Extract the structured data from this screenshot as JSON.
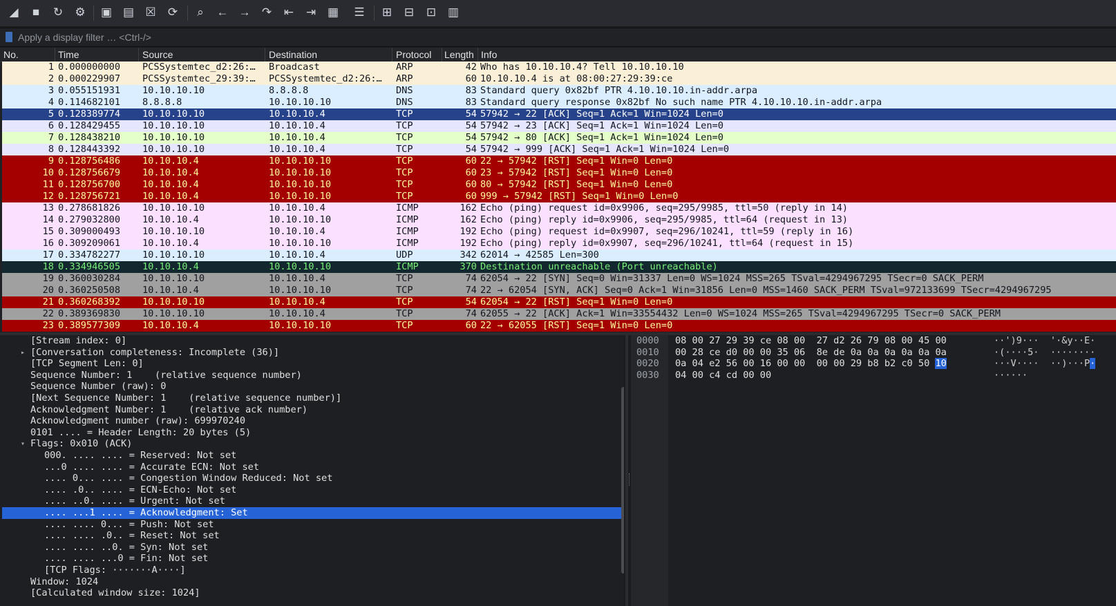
{
  "toolbar": {
    "buttons": [
      {
        "name": "start-capture-icon",
        "glyph": "◢"
      },
      {
        "name": "stop-capture-icon",
        "glyph": "■"
      },
      {
        "name": "restart-capture-icon",
        "glyph": "↻"
      },
      {
        "name": "capture-options-icon",
        "glyph": "⚙"
      },
      {
        "name": "open-file-icon",
        "glyph": "▣"
      },
      {
        "name": "save-file-icon",
        "glyph": "▤"
      },
      {
        "name": "close-file-icon",
        "glyph": "☒"
      },
      {
        "name": "reload-file-icon",
        "glyph": "⟳"
      },
      {
        "name": "find-packet-icon",
        "glyph": "⌕"
      },
      {
        "name": "go-back-icon",
        "glyph": "←"
      },
      {
        "name": "go-forward-icon",
        "glyph": "→"
      },
      {
        "name": "go-to-packet-icon",
        "glyph": "↷"
      },
      {
        "name": "first-packet-icon",
        "glyph": "⇤"
      },
      {
        "name": "last-packet-icon",
        "glyph": "⇥"
      },
      {
        "name": "autoscroll-icon",
        "glyph": "▦"
      },
      {
        "name": "colorize-icon",
        "glyph": "☰"
      },
      {
        "name": "zoom-in-icon",
        "glyph": "⊞"
      },
      {
        "name": "zoom-out-icon",
        "glyph": "⊟"
      },
      {
        "name": "normal-size-icon",
        "glyph": "⊡"
      },
      {
        "name": "resize-columns-icon",
        "glyph": "▥"
      }
    ]
  },
  "filter": {
    "placeholder": "Apply a display filter … <Ctrl-/>",
    "value": ""
  },
  "columns": {
    "no": "No.",
    "time": "Time",
    "source": "Source",
    "destination": "Destination",
    "protocol": "Protocol",
    "length": "Length",
    "info": "Info"
  },
  "packets": [
    {
      "no": "1",
      "time": "0.000000000",
      "src": "PCSSystemtec_d2:26:…",
      "dst": "Broadcast",
      "proto": "ARP",
      "len": "42",
      "info": "Who has 10.10.10.4? Tell 10.10.10.10",
      "bg": "#faf0d7",
      "fg": "#12161c"
    },
    {
      "no": "2",
      "time": "0.000229907",
      "src": "PCSSystemtec_29:39:…",
      "dst": "PCSSystemtec_d2:26:…",
      "proto": "ARP",
      "len": "60",
      "info": "10.10.10.4 is at 08:00:27:29:39:ce",
      "bg": "#faf0d7",
      "fg": "#12161c"
    },
    {
      "no": "3",
      "time": "0.055151931",
      "src": "10.10.10.10",
      "dst": "8.8.8.8",
      "proto": "DNS",
      "len": "83",
      "info": "Standard query 0x82bf PTR 4.10.10.10.in-addr.arpa",
      "bg": "#daeeff",
      "fg": "#12161c"
    },
    {
      "no": "4",
      "time": "0.114682101",
      "src": "8.8.8.8",
      "dst": "10.10.10.10",
      "proto": "DNS",
      "len": "83",
      "info": "Standard query response 0x82bf No such name PTR 4.10.10.10.in-addr.arpa",
      "bg": "#daeeff",
      "fg": "#12161c"
    },
    {
      "no": "5",
      "time": "0.128389774",
      "src": "10.10.10.10",
      "dst": "10.10.10.4",
      "proto": "TCP",
      "len": "54",
      "info": "57942 → 22 [ACK] Seq=1 Ack=1 Win=1024 Len=0",
      "bg": "#26428b",
      "fg": "#ffffff"
    },
    {
      "no": "6",
      "time": "0.128429455",
      "src": "10.10.10.10",
      "dst": "10.10.10.4",
      "proto": "TCP",
      "len": "54",
      "info": "57942 → 23 [ACK] Seq=1 Ack=1 Win=1024 Len=0",
      "bg": "#e7e6ff",
      "fg": "#12161c"
    },
    {
      "no": "7",
      "time": "0.128438210",
      "src": "10.10.10.10",
      "dst": "10.10.10.4",
      "proto": "TCP",
      "len": "54",
      "info": "57942 → 80 [ACK] Seq=1 Ack=1 Win=1024 Len=0",
      "bg": "#e4ffc7",
      "fg": "#12161c"
    },
    {
      "no": "8",
      "time": "0.128443392",
      "src": "10.10.10.10",
      "dst": "10.10.10.4",
      "proto": "TCP",
      "len": "54",
      "info": "57942 → 999 [ACK] Seq=1 Ack=1 Win=1024 Len=0",
      "bg": "#e7e6ff",
      "fg": "#12161c"
    },
    {
      "no": "9",
      "time": "0.128756486",
      "src": "10.10.10.4",
      "dst": "10.10.10.10",
      "proto": "TCP",
      "len": "60",
      "info": "22 → 57942 [RST] Seq=1 Win=0 Len=0",
      "bg": "#a40000",
      "fg": "#fffc9c"
    },
    {
      "no": "10",
      "time": "0.128756679",
      "src": "10.10.10.4",
      "dst": "10.10.10.10",
      "proto": "TCP",
      "len": "60",
      "info": "23 → 57942 [RST] Seq=1 Win=0 Len=0",
      "bg": "#a40000",
      "fg": "#fffc9c"
    },
    {
      "no": "11",
      "time": "0.128756700",
      "src": "10.10.10.4",
      "dst": "10.10.10.10",
      "proto": "TCP",
      "len": "60",
      "info": "80 → 57942 [RST] Seq=1 Win=0 Len=0",
      "bg": "#a40000",
      "fg": "#fffc9c"
    },
    {
      "no": "12",
      "time": "0.128756721",
      "src": "10.10.10.4",
      "dst": "10.10.10.10",
      "proto": "TCP",
      "len": "60",
      "info": "999 → 57942 [RST] Seq=1 Win=0 Len=0",
      "bg": "#a40000",
      "fg": "#fffc9c"
    },
    {
      "no": "13",
      "time": "0.278681826",
      "src": "10.10.10.10",
      "dst": "10.10.10.4",
      "proto": "ICMP",
      "len": "162",
      "info": "Echo (ping) request  id=0x9906, seq=295/9985, ttl=50 (reply in 14)",
      "bg": "#fce0ff",
      "fg": "#12161c"
    },
    {
      "no": "14",
      "time": "0.279032800",
      "src": "10.10.10.4",
      "dst": "10.10.10.10",
      "proto": "ICMP",
      "len": "162",
      "info": "Echo (ping) reply    id=0x9906, seq=295/9985, ttl=64 (request in 13)",
      "bg": "#fce0ff",
      "fg": "#12161c"
    },
    {
      "no": "15",
      "time": "0.309000493",
      "src": "10.10.10.10",
      "dst": "10.10.10.4",
      "proto": "ICMP",
      "len": "192",
      "info": "Echo (ping) request  id=0x9907, seq=296/10241, ttl=59 (reply in 16)",
      "bg": "#fce0ff",
      "fg": "#12161c"
    },
    {
      "no": "16",
      "time": "0.309209061",
      "src": "10.10.10.4",
      "dst": "10.10.10.10",
      "proto": "ICMP",
      "len": "192",
      "info": "Echo (ping) reply    id=0x9907, seq=296/10241, ttl=64 (request in 15)",
      "bg": "#fce0ff",
      "fg": "#12161c"
    },
    {
      "no": "17",
      "time": "0.334782277",
      "src": "10.10.10.10",
      "dst": "10.10.10.4",
      "proto": "UDP",
      "len": "342",
      "info": "62014 → 42585 Len=300",
      "bg": "#daeeff",
      "fg": "#12161c"
    },
    {
      "no": "18",
      "time": "0.334946505",
      "src": "10.10.10.4",
      "dst": "10.10.10.10",
      "proto": "ICMP",
      "len": "370",
      "info": "Destination unreachable (Port unreachable)",
      "bg": "#12272e",
      "fg": "#78f078"
    },
    {
      "no": "19",
      "time": "0.360030284",
      "src": "10.10.10.10",
      "dst": "10.10.10.4",
      "proto": "TCP",
      "len": "74",
      "info": "62054 → 22 [SYN] Seq=0 Win=31337 Len=0 WS=1024 MSS=265 TSval=4294967295 TSecr=0 SACK_PERM",
      "bg": "#a0a0a0",
      "fg": "#12161c"
    },
    {
      "no": "20",
      "time": "0.360250508",
      "src": "10.10.10.4",
      "dst": "10.10.10.10",
      "proto": "TCP",
      "len": "74",
      "info": "22 → 62054 [SYN, ACK] Seq=0 Ack=1 Win=31856 Len=0 MSS=1460 SACK_PERM TSval=972133699 TSecr=4294967295",
      "bg": "#a0a0a0",
      "fg": "#12161c"
    },
    {
      "no": "21",
      "time": "0.360268392",
      "src": "10.10.10.10",
      "dst": "10.10.10.4",
      "proto": "TCP",
      "len": "54",
      "info": "62054 → 22 [RST] Seq=1 Win=0 Len=0",
      "bg": "#a40000",
      "fg": "#fffc9c"
    },
    {
      "no": "22",
      "time": "0.389369830",
      "src": "10.10.10.10",
      "dst": "10.10.10.4",
      "proto": "TCP",
      "len": "74",
      "info": "62055 → 22 [ACK] Ack=1 Win=33554432 Len=0 WS=1024 MSS=265 TSval=4294967295 TSecr=0 SACK_PERM",
      "bg": "#a0a0a0",
      "fg": "#12161c"
    },
    {
      "no": "23",
      "time": "0.389577309",
      "src": "10.10.10.4",
      "dst": "10.10.10.10",
      "proto": "TCP",
      "len": "60",
      "info": "22 → 62055 [RST] Seq=1 Win=0 Len=0",
      "bg": "#a40000",
      "fg": "#fffc9c"
    }
  ],
  "details": [
    {
      "indent": 1,
      "expander": "",
      "text": "[Stream index: 0]"
    },
    {
      "indent": 1,
      "expander": "collapsed",
      "text": "[Conversation completeness: Incomplete (36)]"
    },
    {
      "indent": 1,
      "expander": "",
      "text": "[TCP Segment Len: 0]"
    },
    {
      "indent": 1,
      "expander": "",
      "text": "Sequence Number: 1    (relative sequence number)"
    },
    {
      "indent": 1,
      "expander": "",
      "text": "Sequence Number (raw): 0"
    },
    {
      "indent": 1,
      "expander": "",
      "text": "[Next Sequence Number: 1    (relative sequence number)]"
    },
    {
      "indent": 1,
      "expander": "",
      "text": "Acknowledgment Number: 1    (relative ack number)"
    },
    {
      "indent": 1,
      "expander": "",
      "text": "Acknowledgment number (raw): 699970240"
    },
    {
      "indent": 1,
      "expander": "",
      "text": "0101 .... = Header Length: 20 bytes (5)"
    },
    {
      "indent": 1,
      "expander": "expanded",
      "text": "Flags: 0x010 (ACK)"
    },
    {
      "indent": 2,
      "expander": "",
      "text": "000. .... .... = Reserved: Not set"
    },
    {
      "indent": 2,
      "expander": "",
      "text": "...0 .... .... = Accurate ECN: Not set"
    },
    {
      "indent": 2,
      "expander": "",
      "text": ".... 0... .... = Congestion Window Reduced: Not set"
    },
    {
      "indent": 2,
      "expander": "",
      "text": ".... .0.. .... = ECN-Echo: Not set"
    },
    {
      "indent": 2,
      "expander": "",
      "text": ".... ..0. .... = Urgent: Not set"
    },
    {
      "indent": 2,
      "expander": "",
      "text": ".... ...1 .... = Acknowledgment: Set",
      "selected": true
    },
    {
      "indent": 2,
      "expander": "",
      "text": ".... .... 0... = Push: Not set"
    },
    {
      "indent": 2,
      "expander": "",
      "text": ".... .... .0.. = Reset: Not set"
    },
    {
      "indent": 2,
      "expander": "",
      "text": ".... .... ..0. = Syn: Not set"
    },
    {
      "indent": 2,
      "expander": "",
      "text": ".... .... ...0 = Fin: Not set"
    },
    {
      "indent": 2,
      "expander": "",
      "text": "[TCP Flags: ·······A····]"
    },
    {
      "indent": 1,
      "expander": "",
      "text": "Window: 1024"
    },
    {
      "indent": 1,
      "expander": "",
      "text": "[Calculated window size: 1024]"
    }
  ],
  "hex": [
    {
      "offset": "0000",
      "bytes": "08 00 27 29 39 ce 08 00  27 d2 26 79 08 00 45 00",
      "ascii": "··')9···  '·&y··E·"
    },
    {
      "offset": "0010",
      "bytes": "00 28 ce d0 00 00 35 06  8e de 0a 0a 0a 0a 0a 0a",
      "ascii": "·(····5·  ········"
    },
    {
      "offset": "0020",
      "bytes_pre": "0a 04 e2 56 00 16 00 00  00 00 29 b8 b2 c0 50 ",
      "bytes_hl": "10",
      "ascii_pre": "···V····  ··)···P",
      "ascii_hl": "·"
    },
    {
      "offset": "0030",
      "bytes": "04 00 c4 cd 00 00",
      "ascii": "······"
    }
  ]
}
